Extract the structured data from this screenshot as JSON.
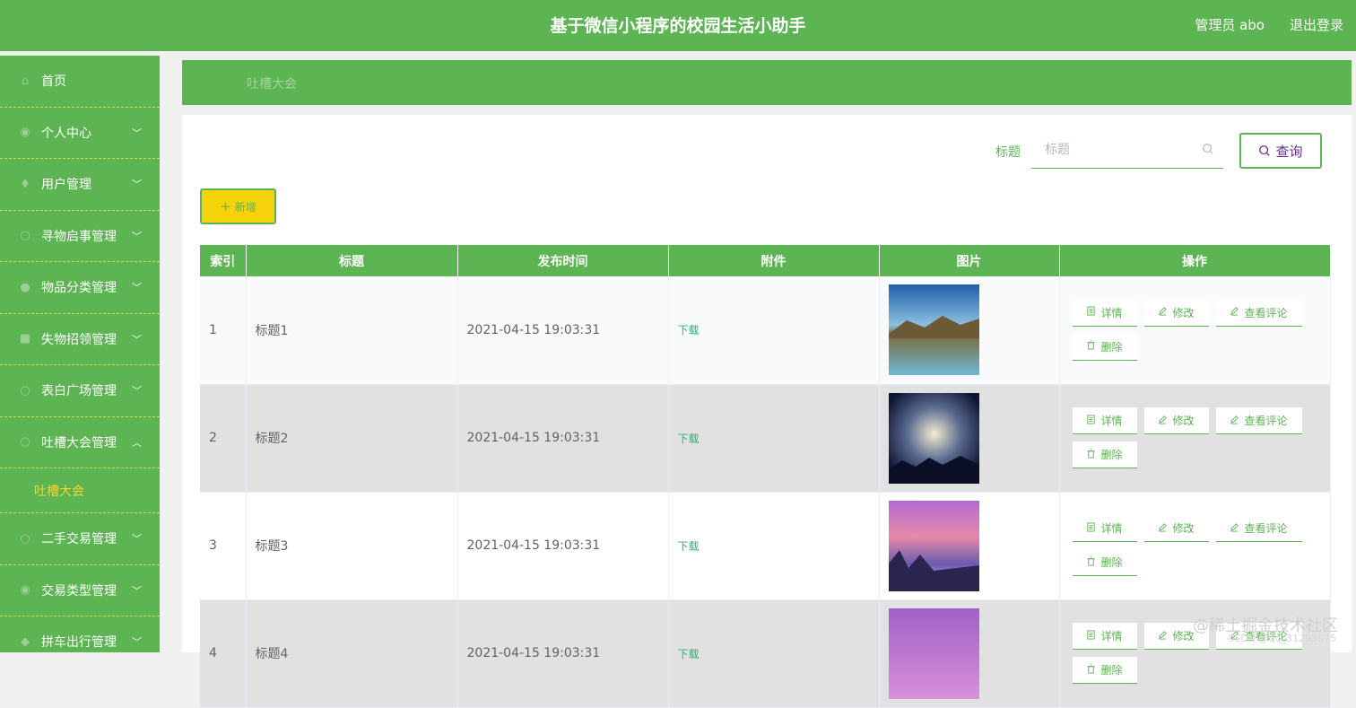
{
  "header": {
    "title": "基于微信小程序的校园生活小助手",
    "user": "管理员 abo",
    "logout": "退出登录"
  },
  "sidebar": {
    "items": [
      {
        "label": "首页",
        "icon": "home-icon",
        "expandable": false
      },
      {
        "label": "个人中心",
        "icon": "user-icon",
        "expandable": true
      },
      {
        "label": "用户管理",
        "icon": "users-icon",
        "expandable": true
      },
      {
        "label": "寻物启事管理",
        "icon": "search-icon",
        "expandable": true
      },
      {
        "label": "物品分类管理",
        "icon": "category-icon",
        "expandable": true
      },
      {
        "label": "失物招领管理",
        "icon": "box-icon",
        "expandable": true
      },
      {
        "label": "表白广场管理",
        "icon": "heart-icon",
        "expandable": true
      },
      {
        "label": "吐槽大会管理",
        "icon": "chat-icon",
        "expandable": true,
        "open": true,
        "sub": "吐槽大会"
      },
      {
        "label": "二手交易管理",
        "icon": "trade-icon",
        "expandable": true
      },
      {
        "label": "交易类型管理",
        "icon": "tag-icon",
        "expandable": true
      },
      {
        "label": "拼车出行管理",
        "icon": "car-icon",
        "expandable": true
      }
    ]
  },
  "breadcrumb": "吐槽大会",
  "search": {
    "label": "标题",
    "placeholder": "标题",
    "button": "查询"
  },
  "add_button": "新增",
  "table": {
    "headers": [
      "索引",
      "标题",
      "发布时间",
      "附件",
      "图片",
      "操作"
    ],
    "rows": [
      {
        "index": "1",
        "title": "标题1",
        "time": "2021-04-15 19:03:31",
        "attachment": "下载",
        "image": "lake"
      },
      {
        "index": "2",
        "title": "标题2",
        "time": "2021-04-15 19:03:31",
        "attachment": "下载",
        "image": "night"
      },
      {
        "index": "3",
        "title": "标题3",
        "time": "2021-04-15 19:03:31",
        "attachment": "下载",
        "image": "pink"
      },
      {
        "index": "4",
        "title": "标题4",
        "time": "2021-04-15 19:03:31",
        "attachment": "下载",
        "image": "purple"
      }
    ],
    "actions": {
      "detail": "详情",
      "edit": "修改",
      "comments": "查看评论",
      "delete": "删除"
    }
  },
  "watermark": {
    "line1": "@稀土掘金技术社区",
    "line2": "CSDN @qq_31293575"
  },
  "colors": {
    "primary": "#5cb452",
    "accent_yellow": "#f5d20a",
    "download_green": "#2db36e"
  }
}
